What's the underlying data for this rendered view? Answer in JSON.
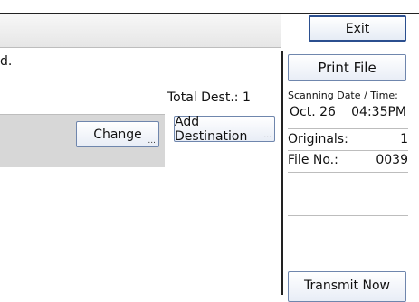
{
  "header": {
    "exit_label": "Exit"
  },
  "main": {
    "message_fragment": "d.",
    "total_dest": "Total Dest.: 1",
    "change_label": "Change",
    "add_destination_label": "Add Destination",
    "ellipsis": "..."
  },
  "side": {
    "print_file_label": "Print File",
    "scanning_date_label": "Scanning Date / Time:",
    "date": "Oct. 26",
    "time": "04:35PM",
    "originals_label": "Originals:",
    "originals_value": "1",
    "file_no_label": "File No.:",
    "file_no_value": "0039",
    "transmit_now_label": "Transmit Now"
  }
}
